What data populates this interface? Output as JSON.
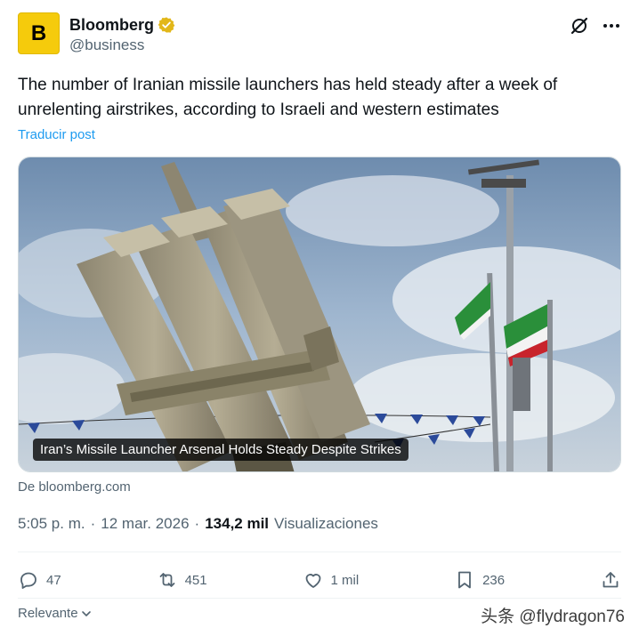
{
  "author": {
    "display_name": "Bloomberg",
    "handle": "@business",
    "avatar_letter": "B",
    "avatar_color": "#f5cb0c",
    "verified_color": "#e2b719"
  },
  "tweet": {
    "text": "The number of Iranian missile launchers has held steady after a week of unrelenting airstrikes, according to Israeli and western estimates",
    "translate_label": "Traducir post"
  },
  "card": {
    "image_caption": "Iran’s Missile Launcher Arsenal Holds Steady Despite Strikes",
    "source_label": "De bloomberg.com",
    "image_icon": "missile-launcher-photo"
  },
  "meta": {
    "time": "5:05 p. m.",
    "separator1": "·",
    "date": "12 mar. 2026",
    "separator2": "·",
    "views_count": "134,2 mil",
    "views_label": "Visualizaciones"
  },
  "actions": {
    "replies": "47",
    "reposts": "451",
    "likes": "1 mil",
    "bookmarks": "236"
  },
  "footer": {
    "sort_label": "Relevante",
    "watermark": "头条 @flydragon76"
  },
  "colors": {
    "accent": "#1d9bf0",
    "muted_text": "#536471",
    "text": "#0f1419"
  }
}
